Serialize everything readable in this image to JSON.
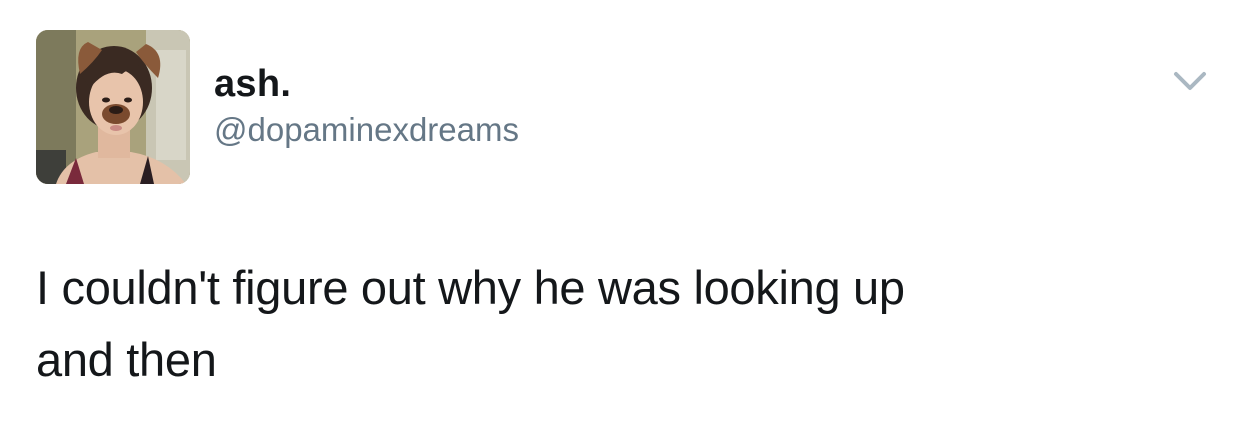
{
  "user": {
    "display_name": "ash.",
    "handle": "@dopaminexdreams"
  },
  "tweet": {
    "text_line1": "I couldn't figure out why he was looking up",
    "text_line2": "and then"
  },
  "icons": {
    "menu": "chevron-down-icon",
    "avatar": "profile-photo"
  },
  "colors": {
    "text": "#14171a",
    "secondary": "#657786",
    "chevron": "#aab8c2"
  }
}
